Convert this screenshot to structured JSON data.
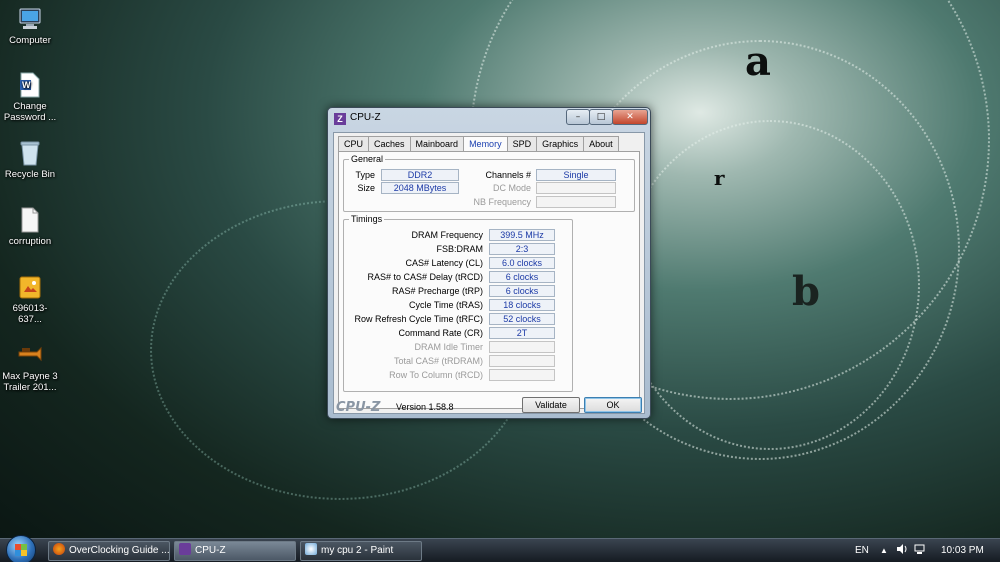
{
  "desktop": {
    "icons": [
      {
        "label": "Computer"
      },
      {
        "label": "Change Password ..."
      },
      {
        "label": "Recycle Bin"
      },
      {
        "label": "corruption"
      },
      {
        "label": "696013-637..."
      },
      {
        "label": "Max Payne 3 Trailer 201..."
      }
    ]
  },
  "window": {
    "title": "CPU-Z",
    "app_icon": "Z",
    "controls": {
      "minimize": "–",
      "maximize": "□",
      "close": "✕"
    },
    "tabs": [
      "CPU",
      "Caches",
      "Mainboard",
      "Memory",
      "SPD",
      "Graphics",
      "About"
    ],
    "active_tab": "Memory",
    "general": {
      "legend": "General",
      "type_label": "Type",
      "type_value": "DDR2",
      "size_label": "Size",
      "size_value": "2048 MBytes",
      "channels_label": "Channels #",
      "channels_value": "Single",
      "dc_mode_label": "DC Mode",
      "nb_frequency_label": "NB Frequency"
    },
    "timings": {
      "legend": "Timings",
      "rows": [
        {
          "label": "DRAM Frequency",
          "value": "399.5 MHz",
          "enabled": true
        },
        {
          "label": "FSB:DRAM",
          "value": "2:3",
          "enabled": true
        },
        {
          "label": "CAS# Latency (CL)",
          "value": "6.0 clocks",
          "enabled": true
        },
        {
          "label": "RAS# to CAS# Delay (tRCD)",
          "value": "6 clocks",
          "enabled": true
        },
        {
          "label": "RAS# Precharge (tRP)",
          "value": "6 clocks",
          "enabled": true
        },
        {
          "label": "Cycle Time (tRAS)",
          "value": "18 clocks",
          "enabled": true
        },
        {
          "label": "Row Refresh Cycle Time (tRFC)",
          "value": "52 clocks",
          "enabled": true
        },
        {
          "label": "Command Rate (CR)",
          "value": "2T",
          "enabled": true
        },
        {
          "label": "DRAM Idle Timer",
          "value": "",
          "enabled": false
        },
        {
          "label": "Total CAS# (tRDRAM)",
          "value": "",
          "enabled": false
        },
        {
          "label": "Row To Column (tRCD)",
          "value": "",
          "enabled": false
        }
      ]
    },
    "footer": {
      "logo": "CPU-Z",
      "version": "Version 1.58.8",
      "validate": "Validate",
      "ok": "OK"
    }
  },
  "taskbar": {
    "items": [
      {
        "label": "OverClocking Guide ...",
        "icon": "firefox-icon",
        "active": false
      },
      {
        "label": "CPU-Z",
        "icon": "cpuz-icon",
        "active": true
      },
      {
        "label": "my cpu 2 - Paint",
        "icon": "paint-icon",
        "active": false
      }
    ],
    "language": "EN",
    "clock": "10:03 PM"
  },
  "wallpaper_letters": [
    "a",
    "r",
    "b"
  ],
  "colors": {
    "value_text": "#1c3aa6",
    "active_tab": "#1a3fb0"
  }
}
